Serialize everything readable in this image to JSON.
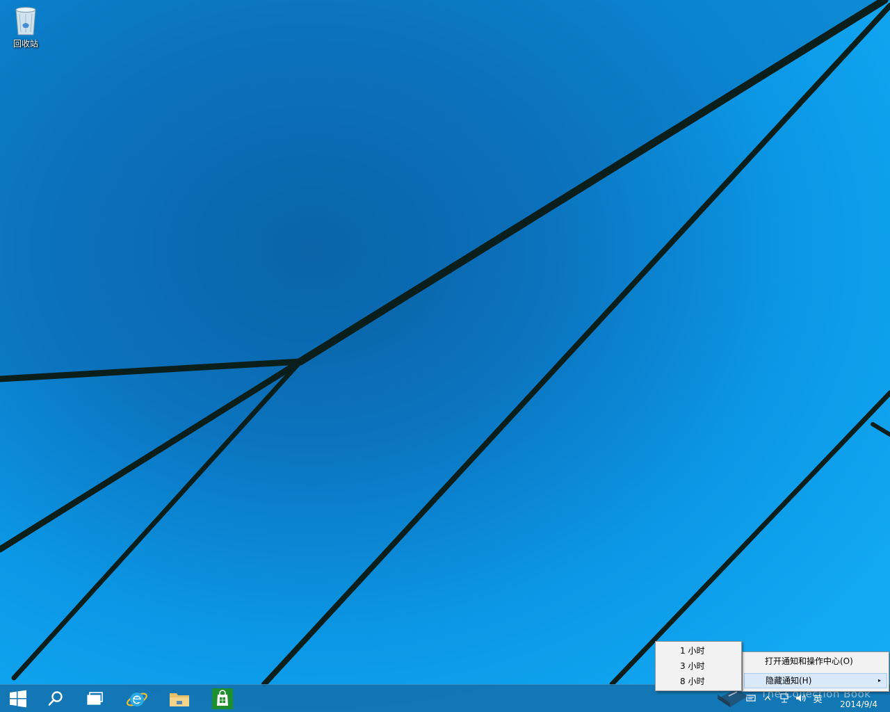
{
  "desktop": {
    "icons": [
      {
        "label": "回收站",
        "icon": "recycle-bin-icon"
      }
    ]
  },
  "taskbar": {
    "buttons": [
      {
        "name": "start",
        "icon": "windows-logo-icon"
      },
      {
        "name": "search",
        "icon": "search-icon"
      },
      {
        "name": "task-view",
        "icon": "task-view-icon"
      },
      {
        "name": "internet-explorer",
        "icon": "internet-explorer-icon"
      },
      {
        "name": "file-explorer",
        "icon": "folder-icon"
      },
      {
        "name": "store",
        "icon": "store-bag-icon"
      }
    ],
    "tray": {
      "ime_label": "英",
      "date": "2014/9/4",
      "watermark": "The Collection Book"
    }
  },
  "context_menu": {
    "items": [
      {
        "label": "打开通知和操作中心(O)"
      },
      {
        "label": "隐藏通知(H)",
        "has_submenu": true,
        "arrow": "▸"
      }
    ]
  },
  "submenu": {
    "items": [
      {
        "label": "1 小时"
      },
      {
        "label": "3 小时"
      },
      {
        "label": "8 小时"
      }
    ]
  },
  "colors": {
    "taskbar": "#1273af",
    "wallpaper": "#12a8f2",
    "menu_bg": "#f2f2f2",
    "menu_hover": "#d9e9f9",
    "store_green": "#1e8f2d"
  }
}
